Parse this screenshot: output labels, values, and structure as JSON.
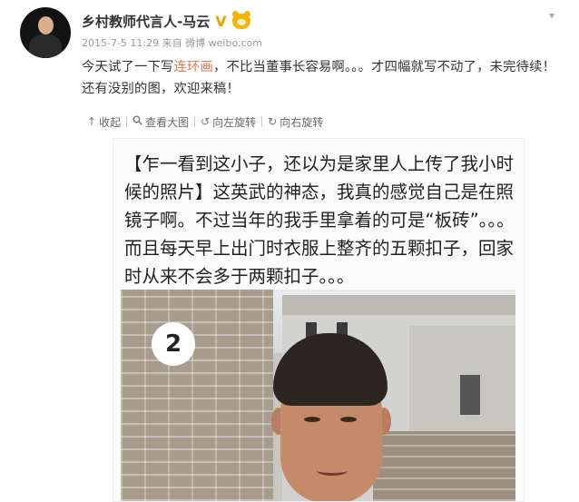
{
  "post": {
    "author": "乡村教师代言人-马云",
    "verified_badge": "V",
    "time": "2015-7-5 11:29",
    "source_prefix": "来自",
    "source": "微博 weibo.com",
    "text_before": "今天试了一下写",
    "text_highlight": "连环画",
    "text_after": "，不比当董事长容易啊。。。才四幅就写不动了，未完待续！还有没别的图，欢迎来稿！",
    "highlight_color": "#eb7350"
  },
  "toolbar": {
    "collapse": "收起",
    "view_large": "查看大图",
    "rotate_left": "向左旋转",
    "rotate_right": "向右旋转"
  },
  "image_card": {
    "caption": "【乍一看到这小子，还以为是家里人上传了我小时候的照片】这英武的神态，我真的感觉自己是在照镜子啊。不过当年的我手里拿着的可是“板砖”。。。而且每天早上出门时衣服上整齐的五颗扣子，回家时从来不会多于两颗扣子。。。",
    "panel_number": "2"
  },
  "icons": {
    "collapse": "arrow-up-icon",
    "view_large": "magnifier-icon",
    "rotate_left": "rotate-left-icon",
    "rotate_right": "rotate-right-icon",
    "menu": "chevron-down-icon"
  }
}
